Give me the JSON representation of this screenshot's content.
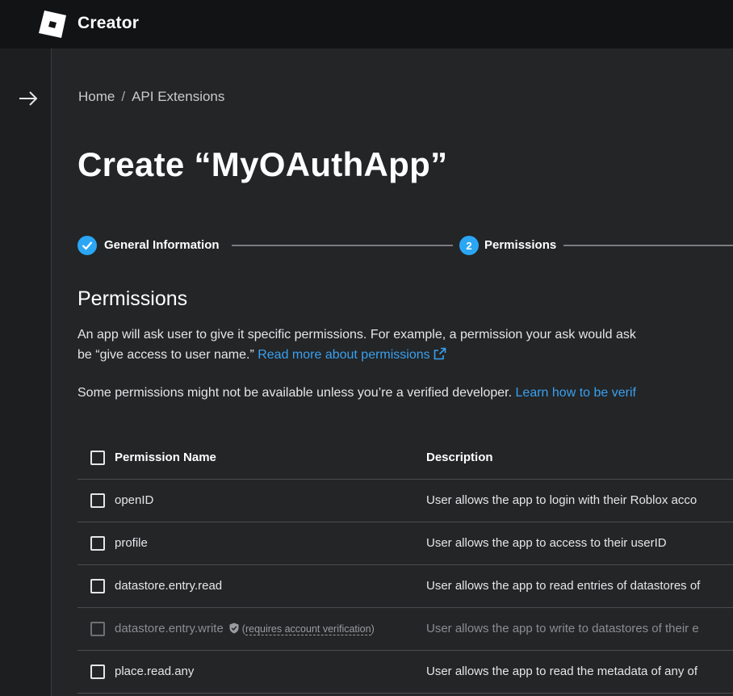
{
  "app": {
    "brand": "Creator"
  },
  "breadcrumb": {
    "home": "Home",
    "separator": "/",
    "current": "API Extensions"
  },
  "page": {
    "title": "Create “MyOAuthApp”"
  },
  "stepper": {
    "steps": [
      {
        "label": "General Information",
        "status": "complete",
        "icon": "check-icon"
      },
      {
        "label": "Permissions",
        "status": "current",
        "number": "2"
      }
    ]
  },
  "permissions": {
    "heading": "Permissions",
    "intro_line1": "An app will ask user to give it specific permissions. For example, a permission your ask would ask",
    "intro_line2": "be “give access to user name.”",
    "read_more_link": "Read more about permissions",
    "verified_note": "Some permissions might not be available unless you’re a verified developer.",
    "verified_link": "Learn how to be verif"
  },
  "table": {
    "headers": {
      "name": "Permission Name",
      "description": "Description"
    },
    "rows": [
      {
        "name": "openID",
        "description": "User allows the app to login with their Roblox acco",
        "disabled": false
      },
      {
        "name": "profile",
        "description": "User allows the app to access to their userID",
        "disabled": false
      },
      {
        "name": "datastore.entry.read",
        "description": "User allows the app to read entries of datastores of",
        "disabled": false
      },
      {
        "name": "datastore.entry.write",
        "description": "User allows the app to write to datastores of their e",
        "disabled": true,
        "note": "requires account verification"
      },
      {
        "name": "place.read.any",
        "description": "User allows the app to read the metadata of any of",
        "disabled": false
      }
    ]
  },
  "colors": {
    "background": "#232527",
    "topbar": "#121314",
    "accent": "#2ba6f5",
    "link": "#3aa0ef"
  }
}
